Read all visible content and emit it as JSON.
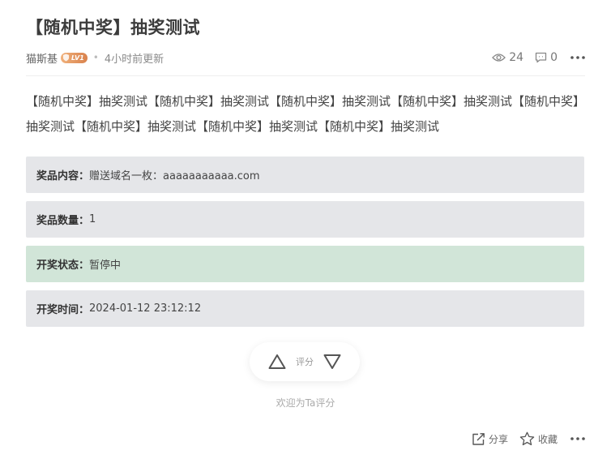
{
  "post": {
    "title": "【随机中奖】抽奖测试",
    "author": "猫斯基",
    "level_badge": "LV1",
    "updated": "4小时前更新",
    "views": "24",
    "comments": "0",
    "body": "【随机中奖】抽奖测试【随机中奖】抽奖测试【随机中奖】抽奖测试【随机中奖】抽奖测试【随机中奖】抽奖测试【随机中奖】抽奖测试【随机中奖】抽奖测试【随机中奖】抽奖测试"
  },
  "lottery": {
    "prize_label": "奖品内容：",
    "prize_value": "赠送域名一枚：aaaaaaaaaaa.com",
    "quantity_label": "奖品数量：",
    "quantity_value": "1",
    "status_label": "开奖状态：",
    "status_value": "暂停中",
    "time_label": "开奖时间：",
    "time_value": "2024-01-12 23:12:12"
  },
  "vote": {
    "label": "评分",
    "welcome": "欢迎为Ta评分"
  },
  "actions": {
    "share": "分享",
    "favorite": "收藏"
  },
  "colors": {
    "info_bg": "#e5e6e9",
    "status_bg": "#d1e5d8",
    "badge": "#d9824d"
  },
  "icons": [
    "eye-icon",
    "comment-icon",
    "more-icon",
    "upvote-icon",
    "downvote-icon",
    "share-icon",
    "star-icon"
  ]
}
